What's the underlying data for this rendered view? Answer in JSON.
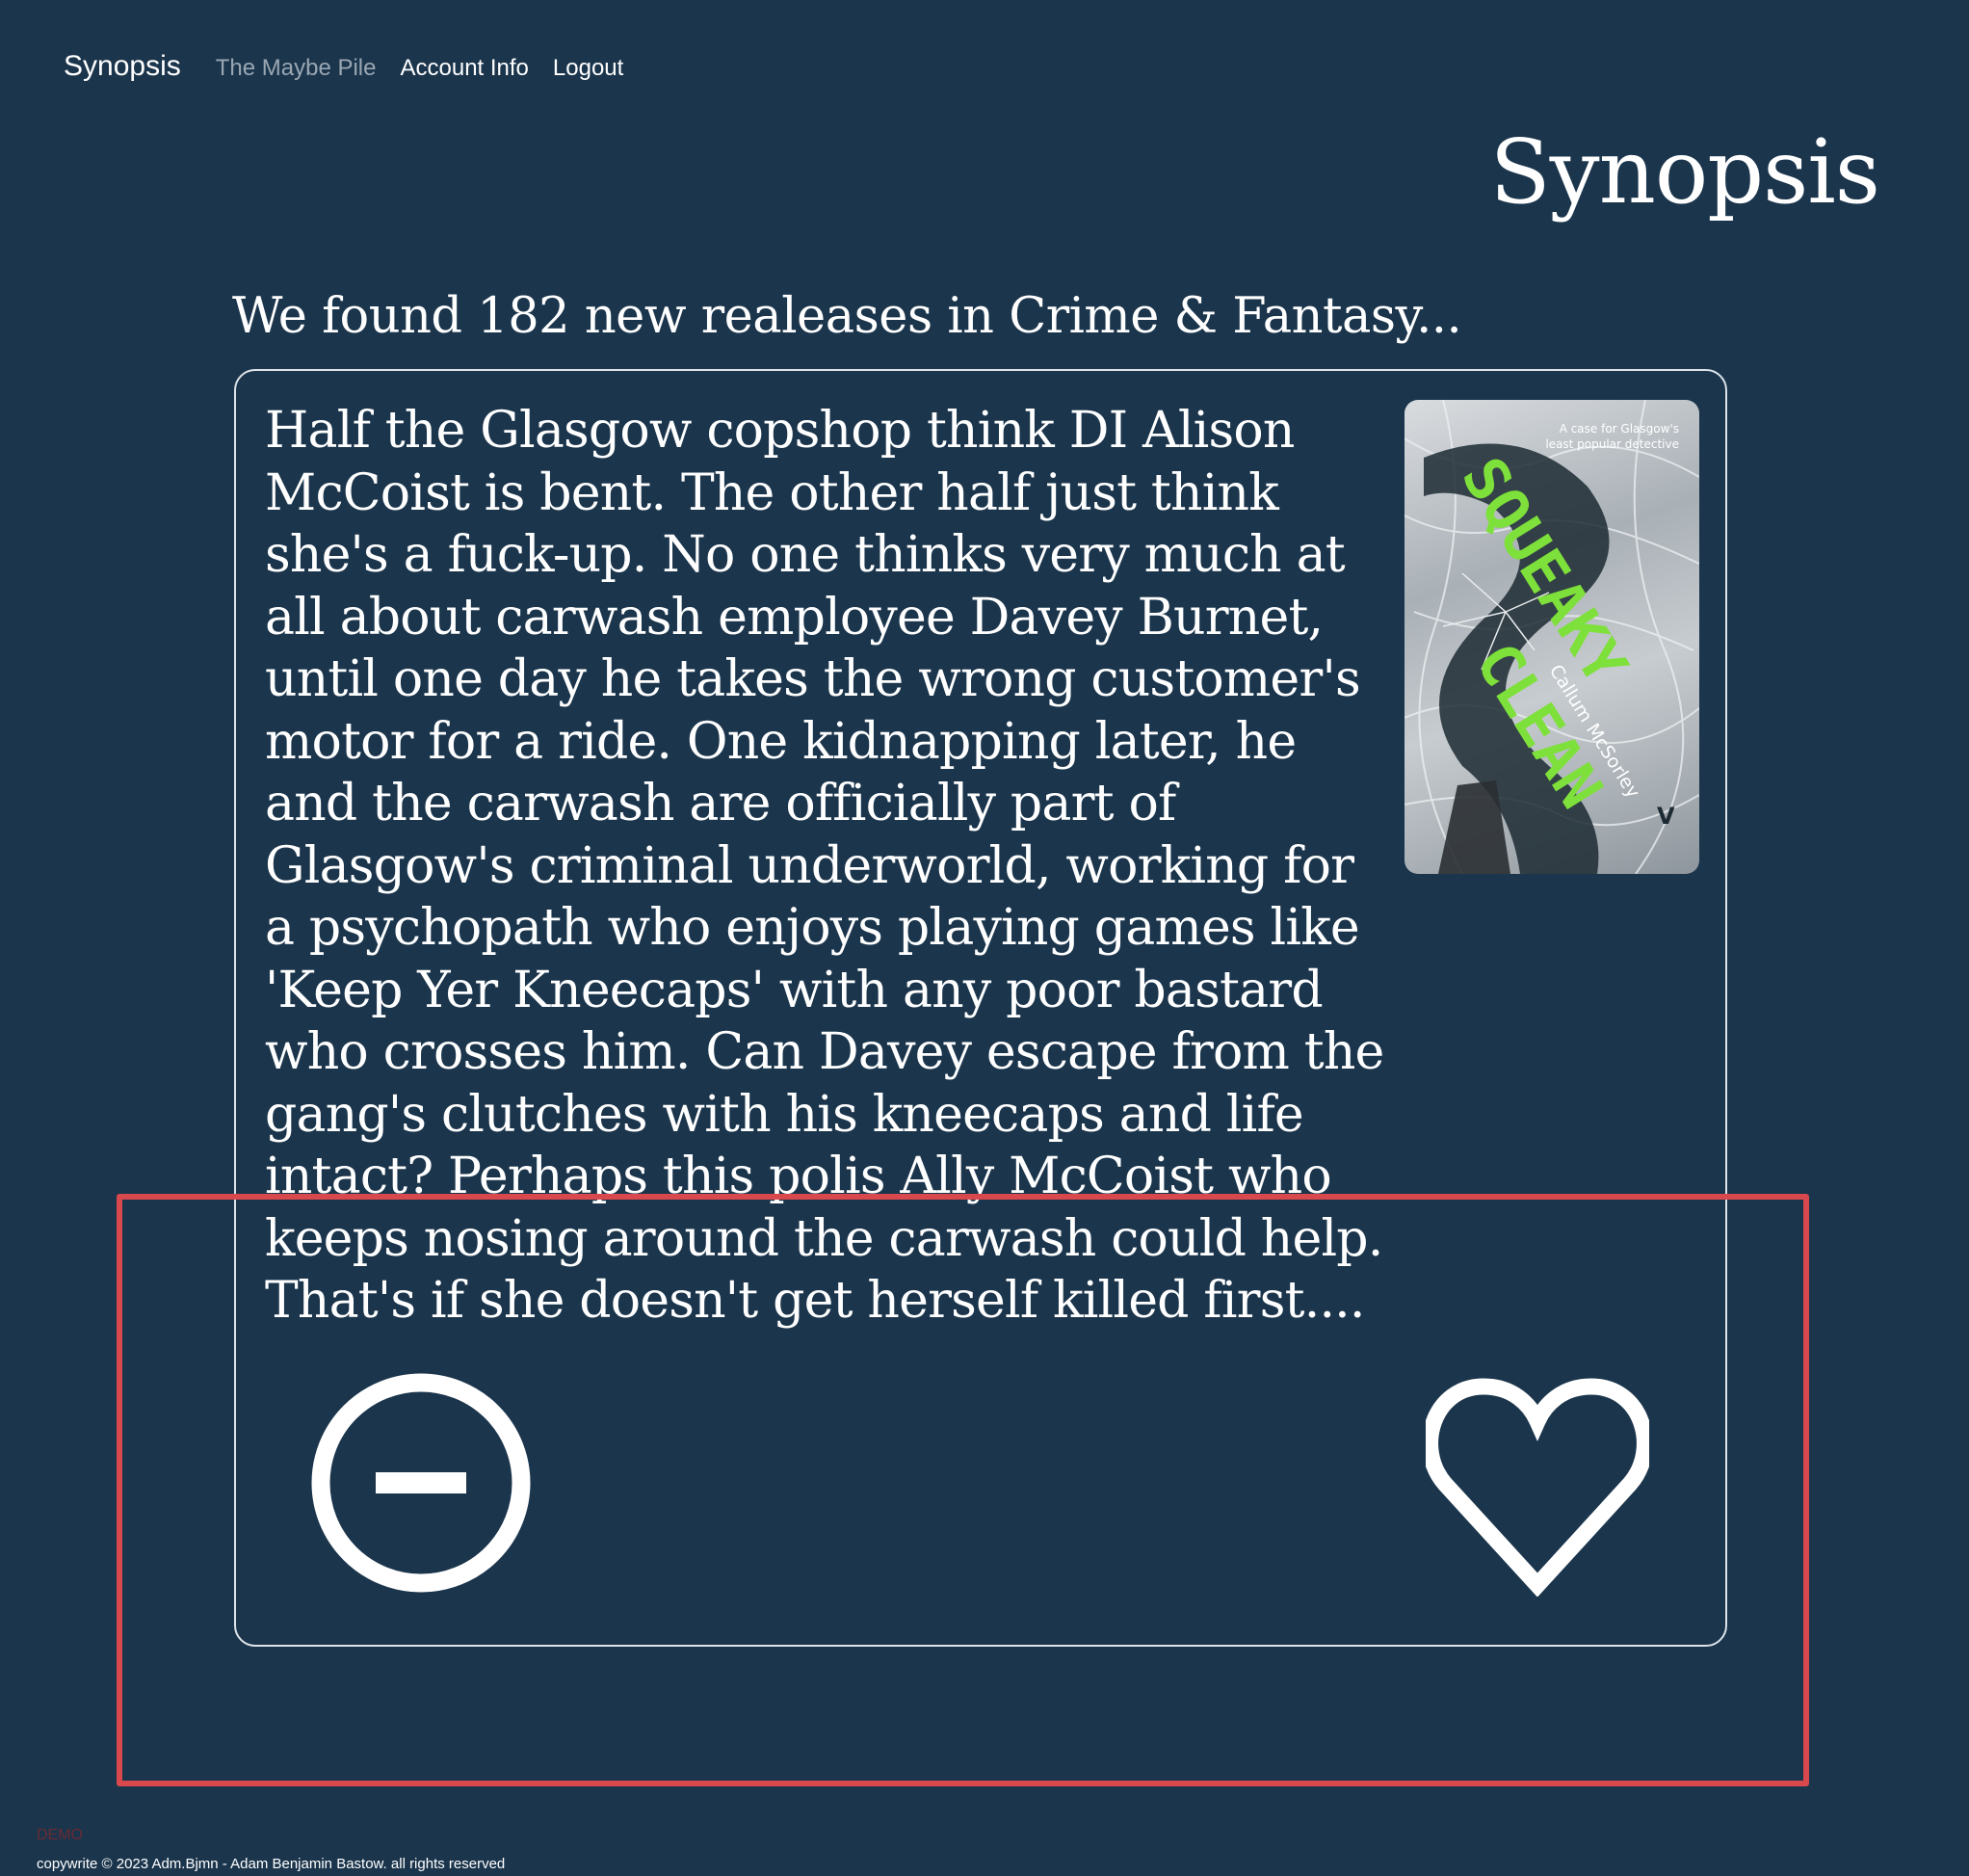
{
  "navbar": {
    "brand": "Synopsis",
    "links": [
      {
        "label": "The Maybe Pile"
      },
      {
        "label": "Account Info"
      },
      {
        "label": "Logout"
      }
    ]
  },
  "page": {
    "title": "Synopsis",
    "results_text": "We found 182 new realeases in Crime & Fantasy..."
  },
  "book": {
    "synopsis": "Half the Glasgow copshop think DI Alison McCoist is bent. The other half just think she's a fuck-up. No one thinks very much at all about carwash employee Davey Burnet, until one day he takes the wrong customer's motor for a ride. One kidnapping later, he and the carwash are officially part of Glasgow's criminal underworld, working for a psychopath who enjoys playing games like 'Keep Yer Kneecaps' with any poor bastard who crosses him. Can Davey escape from the gang's clutches with his kneecaps and life intact? Perhaps this polis Ally McCoist who keeps nosing around the carwash could help. That's if she doesn't get herself killed first....",
    "cover": {
      "tagline_line1": "A case for Glasgow's",
      "tagline_line2": "least popular detective",
      "title_line1": "SQUEAKY",
      "title_line2": "CLEAN",
      "author": "Callum McSorley",
      "publisher_mark": "V",
      "title_color": "#7ee03a"
    }
  },
  "actions": {
    "reject_icon": "minus-circle-icon",
    "like_icon": "heart-outline-icon"
  },
  "footer": {
    "demo_label": "DEMO",
    "copyright": "copywrite © 2023 Adm.Bjmn - Adam Benjamin Bastow. all rights reserved"
  },
  "colors": {
    "background": "#1b354c",
    "highlight": "#d9484c"
  }
}
